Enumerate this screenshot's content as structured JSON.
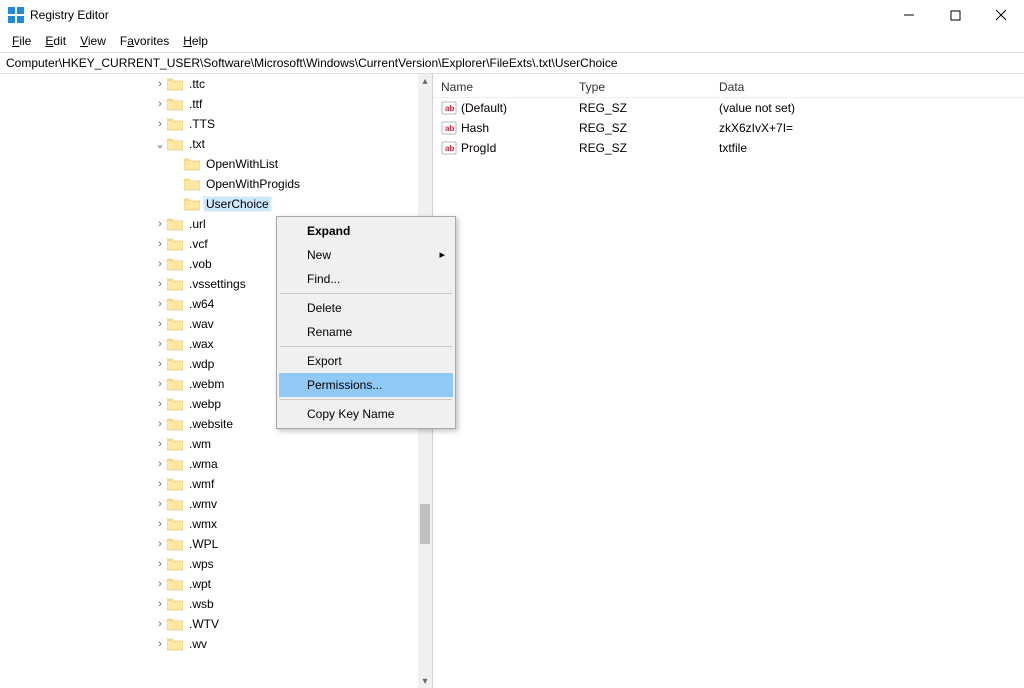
{
  "window": {
    "title": "Registry Editor"
  },
  "menubar": {
    "file": "File",
    "edit": "Edit",
    "view": "View",
    "favorites": "Favorites",
    "help": "Help"
  },
  "address": "Computer\\HKEY_CURRENT_USER\\Software\\Microsoft\\Windows\\CurrentVersion\\Explorer\\FileExts\\.txt\\UserChoice",
  "tree": {
    "items": [
      {
        "indent": 9,
        "expander": ">",
        "label": ".ttc"
      },
      {
        "indent": 9,
        "expander": ">",
        "label": ".ttf"
      },
      {
        "indent": 9,
        "expander": ">",
        "label": ".TTS"
      },
      {
        "indent": 9,
        "expander": "v",
        "label": ".txt"
      },
      {
        "indent": 10,
        "expander": "-",
        "label": "OpenWithList"
      },
      {
        "indent": 10,
        "expander": "-",
        "label": "OpenWithProgids"
      },
      {
        "indent": 10,
        "expander": "-",
        "label": "UserChoice",
        "selected": true
      },
      {
        "indent": 9,
        "expander": ">",
        "label": ".url"
      },
      {
        "indent": 9,
        "expander": ">",
        "label": ".vcf"
      },
      {
        "indent": 9,
        "expander": ">",
        "label": ".vob"
      },
      {
        "indent": 9,
        "expander": ">",
        "label": ".vssettings"
      },
      {
        "indent": 9,
        "expander": ">",
        "label": ".w64"
      },
      {
        "indent": 9,
        "expander": ">",
        "label": ".wav"
      },
      {
        "indent": 9,
        "expander": ">",
        "label": ".wax"
      },
      {
        "indent": 9,
        "expander": ">",
        "label": ".wdp"
      },
      {
        "indent": 9,
        "expander": ">",
        "label": ".webm"
      },
      {
        "indent": 9,
        "expander": ">",
        "label": ".webp"
      },
      {
        "indent": 9,
        "expander": ">",
        "label": ".website"
      },
      {
        "indent": 9,
        "expander": ">",
        "label": ".wm"
      },
      {
        "indent": 9,
        "expander": ">",
        "label": ".wma"
      },
      {
        "indent": 9,
        "expander": ">",
        "label": ".wmf"
      },
      {
        "indent": 9,
        "expander": ">",
        "label": ".wmv"
      },
      {
        "indent": 9,
        "expander": ">",
        "label": ".wmx"
      },
      {
        "indent": 9,
        "expander": ">",
        "label": ".WPL"
      },
      {
        "indent": 9,
        "expander": ">",
        "label": ".wps"
      },
      {
        "indent": 9,
        "expander": ">",
        "label": ".wpt"
      },
      {
        "indent": 9,
        "expander": ">",
        "label": ".wsb"
      },
      {
        "indent": 9,
        "expander": ">",
        "label": ".WTV"
      },
      {
        "indent": 9,
        "expander": ">",
        "label": ".wv"
      }
    ]
  },
  "list": {
    "columns": {
      "name": "Name",
      "type": "Type",
      "data": "Data"
    },
    "rows": [
      {
        "name": "(Default)",
        "type": "REG_SZ",
        "data": "(value not set)"
      },
      {
        "name": "Hash",
        "type": "REG_SZ",
        "data": "zkX6zIvX+7I="
      },
      {
        "name": "ProgId",
        "type": "REG_SZ",
        "data": "txtfile"
      }
    ]
  },
  "contextmenu": {
    "expand": "Expand",
    "new": "New",
    "find": "Find...",
    "delete": "Delete",
    "rename": "Rename",
    "export": "Export",
    "permissions": "Permissions...",
    "copykey": "Copy Key Name"
  }
}
